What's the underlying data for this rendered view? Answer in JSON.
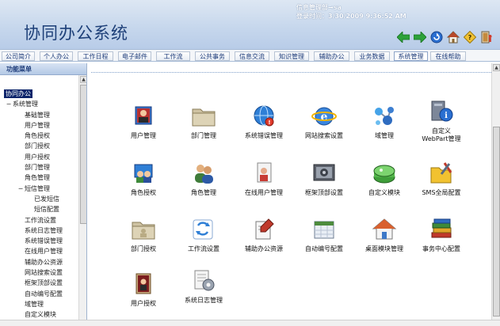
{
  "app": {
    "title": "协同办公系统",
    "user_line": "信息管理部→sa",
    "login_time": "登录时间：3/30/2009 9:36:52 AM"
  },
  "header_icons": [
    "back-arrow-icon",
    "forward-arrow-icon",
    "refresh-icon",
    "home-icon",
    "help-icon",
    "exit-icon"
  ],
  "nav": {
    "tabs": [
      {
        "label": "公司简介"
      },
      {
        "label": "个人办公"
      },
      {
        "label": "工作日程"
      },
      {
        "label": "电子邮件"
      },
      {
        "label": "工作流"
      },
      {
        "label": "公共事务"
      },
      {
        "label": "信息交流"
      },
      {
        "label": "知识管理"
      },
      {
        "label": "辅助办公"
      },
      {
        "label": "业务数据"
      },
      {
        "label": "系统管理"
      },
      {
        "label": "在线帮助"
      }
    ],
    "active": "系统管理"
  },
  "sidebar": {
    "title": "功能菜单",
    "tree": [
      {
        "label": "协同办公",
        "level": 0,
        "selected": true
      },
      {
        "label": "系统管理",
        "level": 1,
        "toggle": "−"
      },
      {
        "label": "基础管理",
        "level": 2
      },
      {
        "label": "用户管理",
        "level": 2
      },
      {
        "label": "角色授权",
        "level": 2
      },
      {
        "label": "部门授权",
        "level": 2
      },
      {
        "label": "用户授权",
        "level": 2
      },
      {
        "label": "部门管理",
        "level": 2
      },
      {
        "label": "角色管理",
        "level": 2
      },
      {
        "label": "短信管理",
        "level": 2,
        "toggle": "−"
      },
      {
        "label": "已发短信",
        "level": 3
      },
      {
        "label": "短信配置",
        "level": 3
      },
      {
        "label": "工作流设置",
        "level": 2
      },
      {
        "label": "系统日志管理",
        "level": 2
      },
      {
        "label": "系统错误管理",
        "level": 2
      },
      {
        "label": "在线用户管理",
        "level": 2
      },
      {
        "label": "辅助办公资源",
        "level": 2
      },
      {
        "label": "网站搜索设置",
        "level": 2
      },
      {
        "label": "框架顶部设置",
        "level": 2
      },
      {
        "label": "自动编号配置",
        "level": 2
      },
      {
        "label": "域管理",
        "level": 2
      },
      {
        "label": "自定义模块",
        "level": 2
      }
    ]
  },
  "modules": [
    {
      "label": "用户管理",
      "icon": "user-manage-icon"
    },
    {
      "label": "部门管理",
      "icon": "folder-icon"
    },
    {
      "label": "系统错误管理",
      "icon": "globe-error-icon"
    },
    {
      "label": "网站搜索设置",
      "icon": "ie-globe-icon"
    },
    {
      "label": "域管理",
      "icon": "domain-molecule-icon"
    },
    {
      "label": "自定义\nWebPart管理",
      "icon": "webpart-info-icon"
    },
    {
      "label": "角色授权",
      "icon": "role-auth-icon"
    },
    {
      "label": "角色管理",
      "icon": "users-group-icon"
    },
    {
      "label": "在线用户管理",
      "icon": "online-user-icon"
    },
    {
      "label": "框架顶部设置",
      "icon": "frame-settings-icon"
    },
    {
      "label": "自定义模块",
      "icon": "custom-module-icon"
    },
    {
      "label": "SMS全局配置",
      "icon": "sms-config-icon"
    },
    {
      "label": "部门授权",
      "icon": "folder-icon"
    },
    {
      "label": "工作流设置",
      "icon": "workflow-icon"
    },
    {
      "label": "辅助办公资源",
      "icon": "office-resource-icon"
    },
    {
      "label": "自动编号配置",
      "icon": "auto-number-icon"
    },
    {
      "label": "桌面模块管理",
      "icon": "desktop-home-icon"
    },
    {
      "label": "事务中心配置",
      "icon": "books-icon"
    },
    {
      "label": "用户授权",
      "icon": "user-auth-icon"
    },
    {
      "label": "系统日志管理",
      "icon": "log-gear-icon"
    }
  ]
}
